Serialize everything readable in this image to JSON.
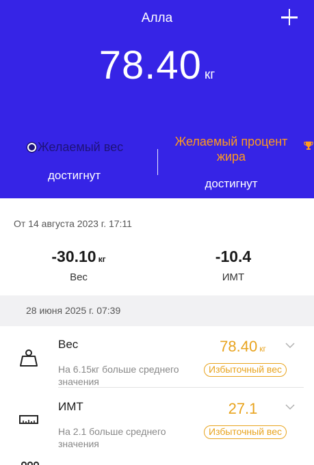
{
  "header": {
    "user_name": "Алла",
    "weight_value": "78.40",
    "weight_unit": "кг",
    "goal_weight": {
      "title": "Желаемый вес",
      "status": "достигнут"
    },
    "goal_fat": {
      "title": "Желаемый процент жира",
      "status": "достигнут"
    }
  },
  "summary": {
    "since_label": "От 14 августа 2023 г. 17:11",
    "weight_diff": {
      "value": "-30.10",
      "unit": "кг",
      "label": "Вес"
    },
    "bmi_diff": {
      "value": "-10.4",
      "label": "ИМТ"
    }
  },
  "measurement_date": "28 июня 2025 г. 07:39",
  "metrics": [
    {
      "icon": "scale-weight-icon",
      "name": "Вес",
      "description": "На 6.15кг больше среднего значения",
      "value": "78.40",
      "unit": "кг",
      "badge": "Избыточный вес"
    },
    {
      "icon": "ruler-icon",
      "name": "ИМТ",
      "description": "На 2.1 больше среднего значения",
      "value": "27.1",
      "unit": "",
      "badge": "Избыточный вес"
    }
  ],
  "colors": {
    "header_bg": "#3624e6",
    "accent_orange": "#ff9a1e",
    "warning_yellow": "#e8a31d",
    "goal_dark": "#1e137a"
  }
}
